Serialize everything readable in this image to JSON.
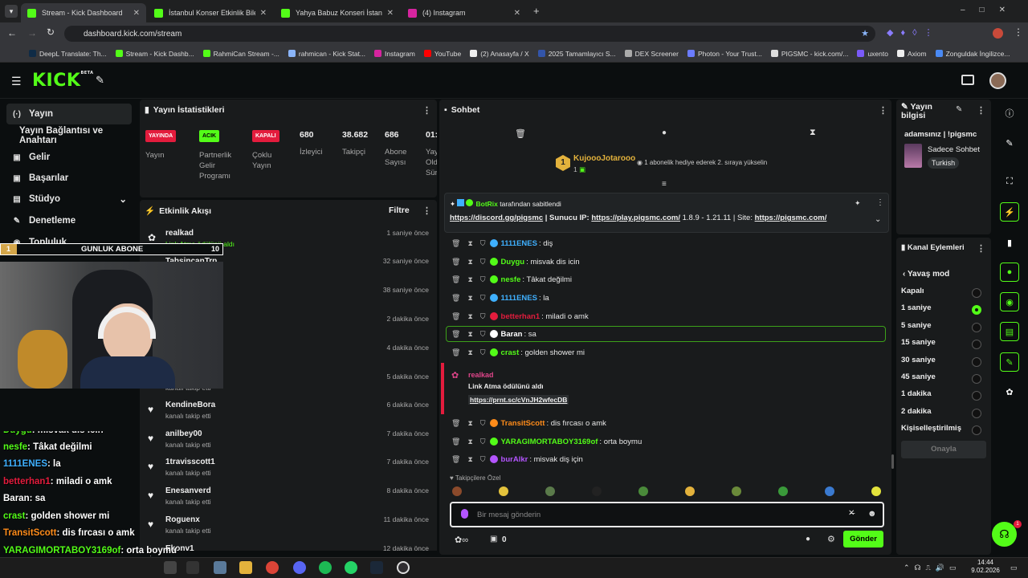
{
  "browser": {
    "tabs": [
      {
        "title": "Stream - Kick Dashboard",
        "active": true
      },
      {
        "title": "İstanbul Konser Etkinlik Biletleri",
        "active": false
      },
      {
        "title": "Yahya Babuz Konseri İstanbul b",
        "active": false
      },
      {
        "title": "(4) Instagram",
        "active": false
      }
    ],
    "url": "dashboard.kick.com/stream",
    "bookmarks": [
      "DeepL Translate: Th...",
      "Stream - Kick Dashb...",
      "RahmiCan Stream -...",
      "rahmican - Kick Stat...",
      "Instagram",
      "YouTube",
      "(2) Anasayfa / X",
      "2025 Tamamlayıcı S...",
      "DEX Screener",
      "Photon - Your Trust...",
      "PIGSMC - kick.com/...",
      "uxento",
      "Axiom",
      "Zonguldak İngilizce..."
    ]
  },
  "app": {
    "logo": "KICK",
    "logo_sup": "BETA"
  },
  "nav": {
    "items": [
      {
        "label": "Yayın",
        "icon": "(·)"
      },
      {
        "label": "Yayın Bağlantısı ve Anahtarı",
        "icon": ""
      },
      {
        "label": "Gelir",
        "icon": "▦"
      },
      {
        "label": "Başarılar",
        "icon": "▦"
      },
      {
        "label": "Stüdyo",
        "icon": "▤"
      },
      {
        "label": "Denetleme",
        "icon": "✎"
      },
      {
        "label": "Topluluk",
        "icon": ""
      }
    ]
  },
  "stats": {
    "title": "Yayın İstatistikleri",
    "badges": [
      {
        "text": "YAYINDA",
        "color": "#e31c3d",
        "label": "Yayın"
      },
      {
        "text": "ACIK",
        "color": "#53fc18",
        "label": "Partnerlik Gelir Programı"
      },
      {
        "text": "KAPALI",
        "color": "#e31c3d",
        "label": "Çoklu Yayın"
      }
    ],
    "numbers": [
      {
        "value": "680",
        "label": "İzleyici"
      },
      {
        "value": "38.682",
        "label": "Takipçi"
      },
      {
        "value": "686",
        "label": "Abone Sayısı"
      },
      {
        "value": "01:",
        "label": "Yay Old Sür"
      }
    ]
  },
  "activity": {
    "title": "Etkinlik Akışı",
    "filter": "Filtre",
    "items": [
      {
        "name": "realkad",
        "sub": "Link Atma ödülünü aldı",
        "time": "1 saniye önce"
      },
      {
        "name": "TahsincanTrp",
        "sub": "",
        "time": "32 saniye önce"
      },
      {
        "name": "",
        "sub": "",
        "time": "38 saniye önce"
      },
      {
        "name": "",
        "sub": "",
        "time": "2 dakika önce"
      },
      {
        "name": "",
        "sub": "",
        "time": "4 dakika önce"
      },
      {
        "name": "",
        "sub": "kanalı takip etti",
        "time": "5 dakika önce"
      },
      {
        "name": "KendineBora",
        "sub": "kanalı takip etti",
        "time": "6 dakika önce"
      },
      {
        "name": "anilbey00",
        "sub": "kanalı takip etti",
        "time": "7 dakika önce"
      },
      {
        "name": "1travisscott1",
        "sub": "kanalı takip etti",
        "time": "7 dakika önce"
      },
      {
        "name": "Enesanverd",
        "sub": "kanalı takip etti",
        "time": "8 dakika önce"
      },
      {
        "name": "Roguenx",
        "sub": "kanalı takip etti",
        "time": "11 dakika önce"
      },
      {
        "name": "Ekonv1",
        "sub": "",
        "time": "12 dakika önce"
      }
    ]
  },
  "overlay": {
    "goal_label": "GUNLUK ABONE",
    "goal_left": "1",
    "goal_right": "10",
    "chat_lines": [
      {
        "user": "Duygu",
        "text": ": misvak dis icin",
        "color": "#53fc18"
      },
      {
        "user": "nesfe",
        "text": ": Tâkat değilmi",
        "color": "#53fc18"
      },
      {
        "user": "1111ENES",
        "text": ": la",
        "color": "#3fb0ff"
      },
      {
        "user": "betterhan1",
        "text": ": miladi o amk",
        "color": "#e31c3d"
      },
      {
        "user": "Baran",
        "text": ": sa",
        "color": "#ffffff"
      },
      {
        "user": "crast",
        "text": ": golden shower mi",
        "color": "#53fc18"
      },
      {
        "user": "TransitScott",
        "text": ": dis fırcası o amk",
        "color": "#ff8c1a"
      },
      {
        "user": "YARAGIMORTABOY3169of",
        "text": ": orta boymu",
        "color": "#53fc18"
      },
      {
        "user": "burAlkr",
        "text": ": misvak diş için",
        "color": "#b455ff"
      }
    ]
  },
  "chat": {
    "title": "Sohbet",
    "top_gifter": {
      "name": "KujoooJotarooo",
      "count": "1",
      "rank": "1",
      "promo": "1 abonelik hediye ederek 2. sıraya yükselin"
    },
    "pinned": {
      "by": "BotRix",
      "by_suffix": "tarafından sabitlendi",
      "link1": "https://discord.gg/pigsmc",
      "mid1": " | Sunucu IP: ",
      "link2": "https://play.pigsmc.com/",
      "mid2": " 1.8.9 - 1.21.11 | Site: ",
      "link3": "https://pigsmc.com/"
    },
    "messages": [
      {
        "user": "1111ENES",
        "text": ": diş",
        "color": "#3fb0ff"
      },
      {
        "user": "Duygu",
        "text": ": misvak dis icin",
        "color": "#53fc18"
      },
      {
        "user": "nesfe",
        "text": ": Tâkat değilmi",
        "color": "#53fc18"
      },
      {
        "user": "1111ENES",
        "text": ": la",
        "color": "#3fb0ff"
      },
      {
        "user": "betterhan1",
        "text": ": miladi o amk",
        "color": "#e31c3d"
      },
      {
        "user": "Baran",
        "text": ": sa",
        "color": "#ffffff"
      },
      {
        "user": "crast",
        "text": ": golden shower mi",
        "color": "#53fc18"
      }
    ],
    "reward": {
      "user": "realkad",
      "text": "Link Atma ödülünü aldı",
      "link": "https://prnt.sc/cVnJH2wfecDB"
    },
    "messages2": [
      {
        "user": "TransitScott",
        "text": ": dis fırcası o amk",
        "color": "#ff8c1a"
      },
      {
        "user": "YARAGIMORTABOY3169of",
        "text": ": orta boymu",
        "color": "#53fc18"
      },
      {
        "user": "burAlkr",
        "text": ": misvak diş için",
        "color": "#b455ff"
      }
    ],
    "followers_only": "Takipçilere Özel",
    "input_placeholder": "Bir mesaj gönderin",
    "send": "Gönder",
    "count": "0"
  },
  "stream_info": {
    "title": "Yayın bilgisi",
    "stream_title": "adamsınız | !pigsmc",
    "category": "Sadece Sohbet",
    "language": "Turkish"
  },
  "channel_actions": {
    "title": "Kanal Eylemleri",
    "slow_mode": "Yavaş mod",
    "options": [
      "Kapalı",
      "1 saniye",
      "5 saniye",
      "15 saniye",
      "30 saniye",
      "45 saniye",
      "1 dakika",
      "2 dakika",
      "Kişiselleştirilmiş"
    ],
    "selected": "1 saniye",
    "confirm": "Onayla"
  },
  "taskbar": {
    "time": "14:44",
    "date": "9.02.2026"
  }
}
